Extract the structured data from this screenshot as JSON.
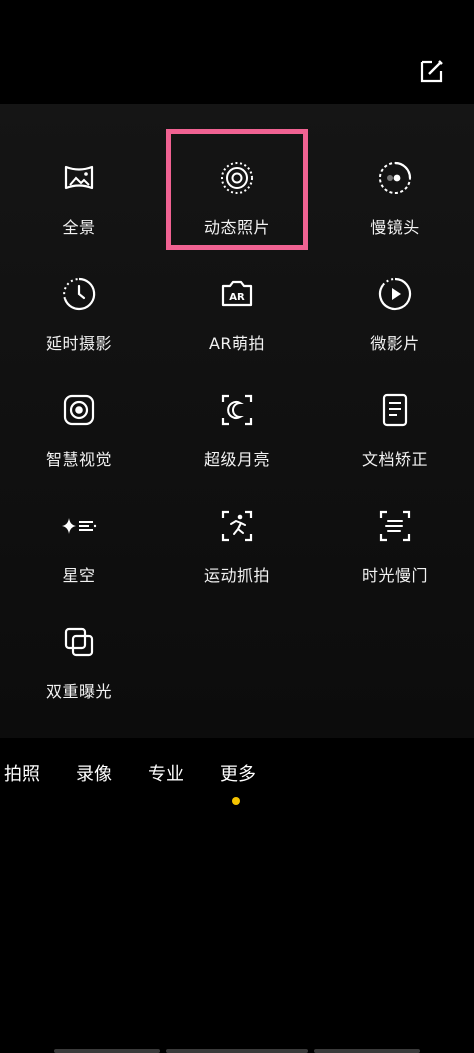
{
  "header": {
    "edit_icon": "edit-icon"
  },
  "modes_grid": [
    {
      "key": "panorama",
      "label": "全景",
      "icon": "panorama-icon"
    },
    {
      "key": "live-photo",
      "label": "动态照片",
      "icon": "live-photo-icon",
      "selected": true
    },
    {
      "key": "slow-motion",
      "label": "慢镜头",
      "icon": "slow-motion-icon"
    },
    {
      "key": "time-lapse",
      "label": "延时摄影",
      "icon": "time-lapse-icon"
    },
    {
      "key": "ar-sticker",
      "label": "AR萌拍",
      "icon": "ar-icon"
    },
    {
      "key": "micro-video",
      "label": "微影片",
      "icon": "micro-video-icon"
    },
    {
      "key": "smart-vision",
      "label": "智慧视觉",
      "icon": "smart-vision-icon"
    },
    {
      "key": "super-moon",
      "label": "超级月亮",
      "icon": "moon-icon"
    },
    {
      "key": "doc-correct",
      "label": "文档矫正",
      "icon": "document-icon"
    },
    {
      "key": "starry-sky",
      "label": "星空",
      "icon": "stars-icon"
    },
    {
      "key": "sport-capture",
      "label": "运动抓拍",
      "icon": "sport-icon"
    },
    {
      "key": "slow-shutter",
      "label": "时光慢门",
      "icon": "slow-shutter-icon"
    },
    {
      "key": "double-expo",
      "label": "双重曝光",
      "icon": "double-exposure-icon"
    }
  ],
  "mode_bar": {
    "items": [
      "拍照",
      "录像",
      "专业",
      "更多"
    ],
    "active_index": 3
  },
  "colors": {
    "highlight": "#f06292",
    "active_dot": "#f5c400"
  }
}
